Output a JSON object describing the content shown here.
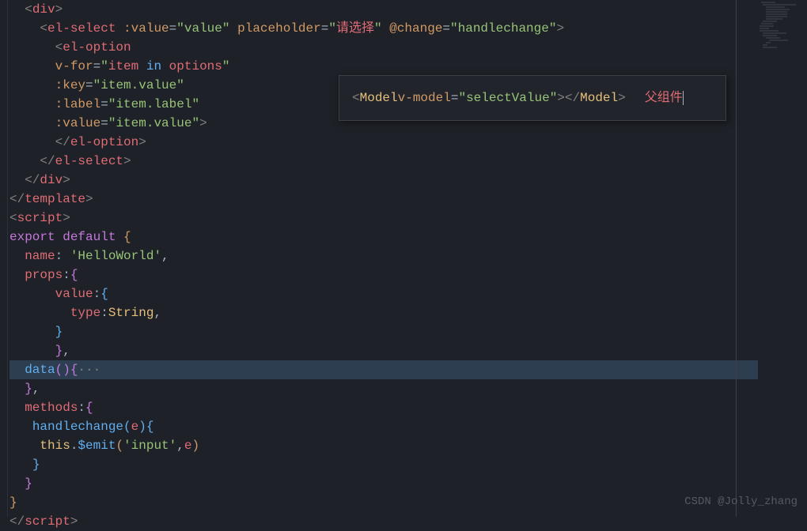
{
  "code": {
    "line1": {
      "tag": "div"
    },
    "line2": {
      "tag": "el-select",
      "attr1": ":value",
      "val1": "value",
      "attr2": "placeholder",
      "val2": "请选择",
      "attr3": "@change",
      "val3": "handlechange"
    },
    "line3": {
      "tag": "el-option"
    },
    "line4": {
      "attr": "v-for",
      "val": "item in options",
      "item": "item",
      "in": "in",
      "options": "options"
    },
    "line5": {
      "attr": ":key",
      "val": "item.value"
    },
    "line6": {
      "attr": ":label",
      "val": "item.label"
    },
    "line7": {
      "attr": ":value",
      "val": "item.value"
    },
    "line8": {
      "tag": "el-option"
    },
    "line9": {
      "tag": "el-select"
    },
    "line10": {
      "tag": "div"
    },
    "line11": {
      "tag": "template"
    },
    "line12": {
      "tag": "script"
    },
    "line13": {
      "export": "export",
      "default": "default"
    },
    "line14": {
      "key": "name",
      "val": "'HelloWorld'"
    },
    "line15": {
      "key": "props"
    },
    "line16": {
      "key": "value"
    },
    "line17": {
      "key": "type",
      "val": "String"
    },
    "line20": {
      "key": "data",
      "dots": "···"
    },
    "line22": {
      "key": "methods"
    },
    "line23": {
      "fn": "handlechange",
      "param": "e"
    },
    "line24": {
      "this": "this",
      "emit": "$emit",
      "event": "'input'",
      "arg": "e"
    },
    "line28": {
      "tag": "script"
    }
  },
  "overlay": {
    "tag": "Model",
    "attr": "v-model",
    "val": "selectValue",
    "label": "父组件"
  },
  "watermark": "CSDN @Jolly_zhang"
}
